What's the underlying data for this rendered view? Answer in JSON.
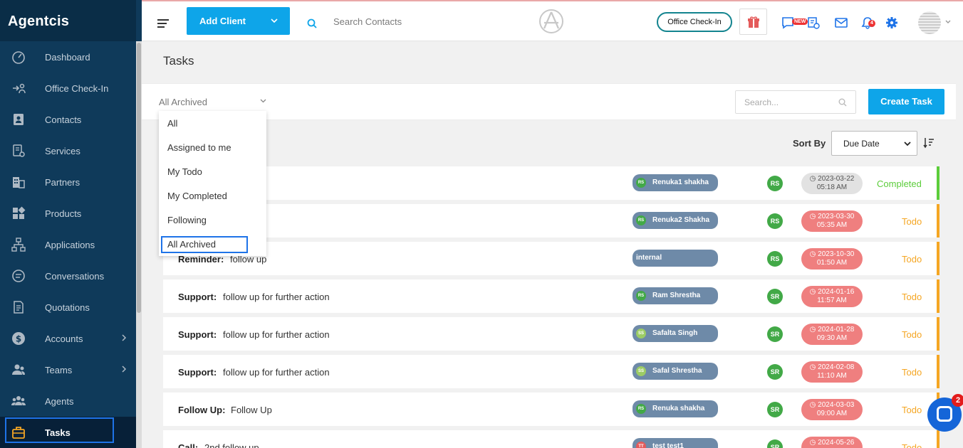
{
  "brand": "Agentcis",
  "sidebar": {
    "items": [
      {
        "label": "Dashboard",
        "icon": "dashboard-icon"
      },
      {
        "label": "Office Check-In",
        "icon": "checkin-icon"
      },
      {
        "label": "Contacts",
        "icon": "contacts-icon"
      },
      {
        "label": "Services",
        "icon": "services-icon"
      },
      {
        "label": "Partners",
        "icon": "partners-icon"
      },
      {
        "label": "Products",
        "icon": "products-icon"
      },
      {
        "label": "Applications",
        "icon": "applications-icon"
      },
      {
        "label": "Conversations",
        "icon": "conversations-icon"
      },
      {
        "label": "Quotations",
        "icon": "quotations-icon"
      },
      {
        "label": "Accounts",
        "icon": "accounts-icon",
        "expandable": true
      },
      {
        "label": "Teams",
        "icon": "teams-icon",
        "expandable": true
      },
      {
        "label": "Agents",
        "icon": "agents-icon"
      },
      {
        "label": "Tasks",
        "icon": "briefcase-icon",
        "active": true
      }
    ]
  },
  "topbar": {
    "add_client": "Add Client",
    "search_placeholder": "Search Contacts",
    "office_checkin": "Office Check-In",
    "new_badge": "NEW",
    "notif_count": "4"
  },
  "page": {
    "title": "Tasks",
    "filter_value": "All Archived",
    "search_placeholder": "Search...",
    "create_task": "Create Task",
    "sort_label": "Sort By",
    "sort_value": "Due Date"
  },
  "dropdown": {
    "options": [
      "All",
      "Assigned to me",
      "My Todo",
      "My Completed",
      "Following",
      "All Archived"
    ],
    "selected": "All Archived"
  },
  "tasks": [
    {
      "category": "",
      "description": "",
      "assignee": "Renuka1 shakha",
      "assignee_initials": "RS",
      "owner": "RS",
      "due_date": "2023-03-22",
      "due_time": "05:18 AM",
      "status": "Completed"
    },
    {
      "category": "",
      "description": "",
      "assignee": "Renuka2 Shakha",
      "assignee_initials": "RS",
      "owner": "RS",
      "due_date": "2023-03-30",
      "due_time": "05:35 AM",
      "status": "Todo"
    },
    {
      "category": "Reminder:",
      "description": "follow up",
      "assignee": "internal",
      "assignee_initials": "",
      "owner": "RS",
      "due_date": "2023-10-30",
      "due_time": "01:50 AM",
      "status": "Todo"
    },
    {
      "category": "Support:",
      "description": "follow up for further action",
      "assignee": "Ram Shrestha",
      "assignee_initials": "RS",
      "owner": "SR",
      "due_date": "2024-01-16",
      "due_time": "11:57 AM",
      "status": "Todo"
    },
    {
      "category": "Support:",
      "description": "follow up for further action",
      "assignee": "Safalta Singh",
      "assignee_initials": "SS",
      "owner": "SR",
      "due_date": "2024-01-28",
      "due_time": "09:30 AM",
      "status": "Todo"
    },
    {
      "category": "Support:",
      "description": "follow up for further action",
      "assignee": "Safal Shrestha",
      "assignee_initials": "SS",
      "owner": "SR",
      "due_date": "2024-02-08",
      "due_time": "11:10 AM",
      "status": "Todo"
    },
    {
      "category": "Follow Up:",
      "description": "Follow Up",
      "assignee": "Renuka shakha",
      "assignee_initials": "RS",
      "owner": "SR",
      "due_date": "2024-03-03",
      "due_time": "09:00 AM",
      "status": "Todo"
    },
    {
      "category": "Call:",
      "description": "2nd follow up",
      "assignee": "test test1",
      "assignee_initials": "TT",
      "owner": "SR",
      "due_date": "2024-05-26",
      "due_time": "",
      "status": "Todo"
    }
  ],
  "chat_badge": "2",
  "colors": {
    "primary": "#0ea5e9",
    "sidebar": "#0f3a5a",
    "todo": "#f5a623",
    "completed": "#5ccd3b",
    "overdue": "#ef7f7f"
  }
}
